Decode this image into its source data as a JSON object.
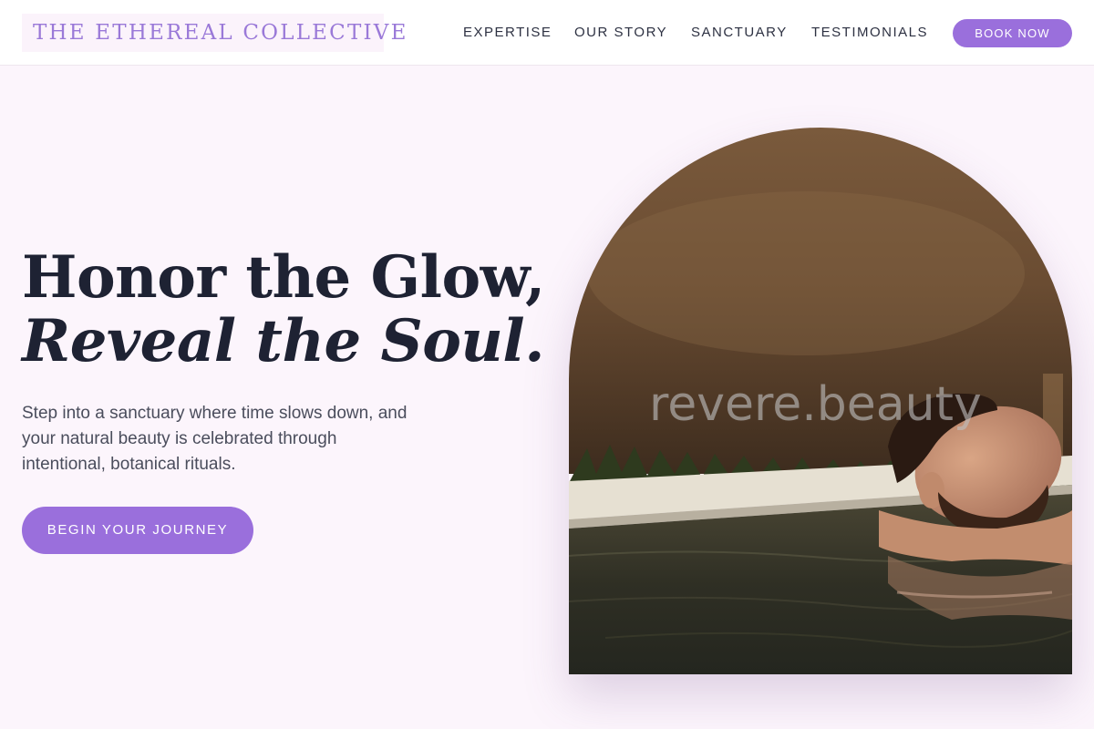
{
  "header": {
    "brand": "THE ETHEREAL COLLECTIVE",
    "nav": [
      "EXPERTISE",
      "OUR STORY",
      "SANCTUARY",
      "TESTIMONIALS"
    ],
    "cta": "BOOK NOW"
  },
  "hero": {
    "title_line1": "Honor the Glow,",
    "title_line2": "Reveal the Soul.",
    "body": "Step into a sanctuary where time slows down, and your natural beauty is celebrated through intentional, botanical rituals.",
    "cta": "BEGIN YOUR JOURNEY",
    "image": {
      "subject": "man-relaxing-in-pool-photo",
      "watermark": "revere.beauty"
    }
  },
  "colors": {
    "accent": "#9a6fdc",
    "brand_text": "#9a79d8",
    "page_background": "#fcf5fc",
    "heading_text": "#1e2233"
  }
}
